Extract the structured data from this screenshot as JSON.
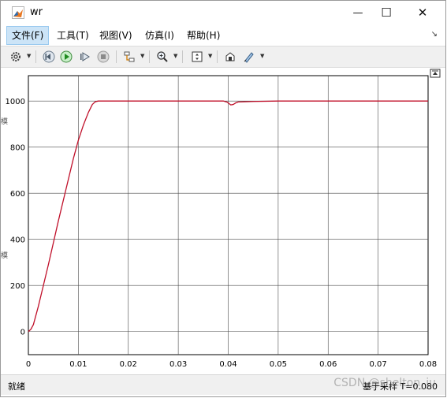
{
  "window": {
    "title": "wr",
    "controls": {
      "minimize": "—",
      "maximize": "☐",
      "close": "✕"
    }
  },
  "menu": {
    "items": [
      "文件(F)",
      "工具(T)",
      "视图(V)",
      "仿真(I)",
      "帮助(H)"
    ],
    "active_index": 0
  },
  "toolbar": {
    "icons": [
      "gear-icon",
      "step-back-icon",
      "run-icon",
      "step-forward-icon",
      "stop-icon",
      "signal-select-icon",
      "zoom-icon",
      "fit-axes-icon",
      "highlight-icon",
      "style-icon"
    ]
  },
  "status": {
    "left": "就绪",
    "right": "基于采样  T=0.080"
  },
  "watermark": "CSDN @shelton_ju",
  "side_glyph": "模",
  "colors": {
    "line": "#c0102a",
    "grid": "#4a4a4a",
    "menu_active_bg": "#cce4f7"
  },
  "chart_data": {
    "type": "line",
    "title": "",
    "xlabel": "",
    "ylabel": "",
    "xlim": [
      0,
      0.08
    ],
    "ylim": [
      -100,
      1110
    ],
    "xticks": [
      0,
      0.01,
      0.02,
      0.03,
      0.04,
      0.05,
      0.06,
      0.07,
      0.08
    ],
    "xtick_labels": [
      "0",
      "0.01",
      "0.02",
      "0.03",
      "0.04",
      "0.05",
      "0.06",
      "0.07",
      "0.08"
    ],
    "yticks": [
      0,
      200,
      400,
      600,
      800,
      1000
    ],
    "ytick_labels": [
      "0",
      "200",
      "400",
      "600",
      "800",
      "1000"
    ],
    "grid": true,
    "series": [
      {
        "x": [
          0,
          0.0005,
          0.001,
          0.002,
          0.003,
          0.004,
          0.005,
          0.006,
          0.007,
          0.008,
          0.009,
          0.01,
          0.011,
          0.012,
          0.0128,
          0.0134,
          0.014,
          0.015,
          0.02,
          0.03,
          0.039,
          0.0398,
          0.0405,
          0.041,
          0.0415,
          0.042,
          0.045,
          0.05,
          0.06,
          0.07,
          0.08
        ],
        "y": [
          0,
          10,
          30,
          110,
          200,
          290,
          385,
          480,
          570,
          660,
          750,
          830,
          895,
          950,
          985,
          997,
          1000,
          1000,
          1000,
          1000,
          1000,
          995,
          983,
          985,
          992,
          996,
          998,
          1000,
          1000,
          1000,
          1000
        ]
      }
    ]
  }
}
